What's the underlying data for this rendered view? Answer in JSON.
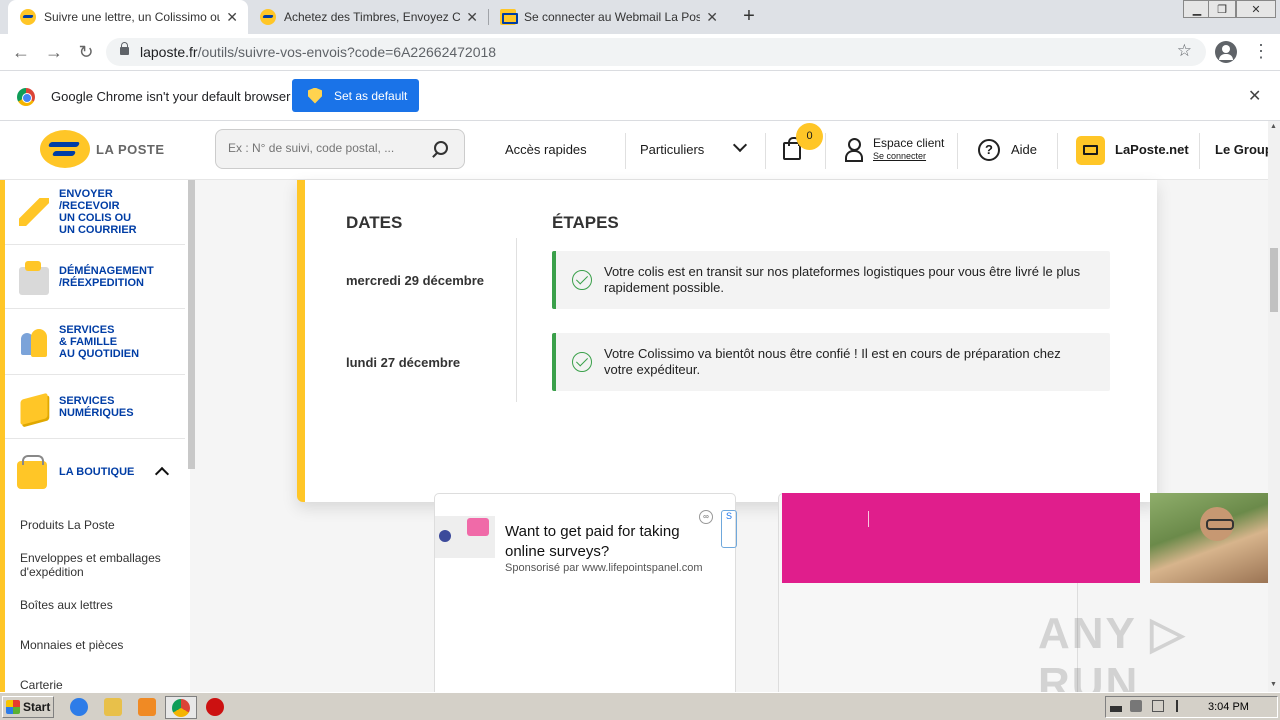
{
  "browser": {
    "tabs": [
      {
        "title": "Suivre une lettre, un Colissimo ou un",
        "active": true
      },
      {
        "title": "Achetez des Timbres, Envoyez Courr",
        "active": false
      },
      {
        "title": "Se connecter au Webmail La Poste -",
        "active": false
      }
    ],
    "tab_close": "✕",
    "new_tab": "+",
    "url_host": "laposte.fr",
    "url_path": "/outils/suivre-vos-envois?code=6A22662472018",
    "nav": {
      "back": "←",
      "forward": "→",
      "reload": "↻"
    },
    "bookmark_star": "☆",
    "menu": "⋮",
    "window_controls": {
      "minimize": "▁",
      "restore": "❐",
      "close": "✕"
    }
  },
  "infobar": {
    "message": "Google Chrome isn't your default browser",
    "button": "Set as default",
    "close": "✕"
  },
  "header": {
    "logo_text": "LA POSTE",
    "search_placeholder": "Ex : N° de suivi, code postal, ...",
    "quick_access": "Accès rapides",
    "audience": "Particuliers",
    "cart_count": "0",
    "account_title": "Espace client",
    "account_sub": "Se connecter",
    "help": "Aide",
    "webmail": "LaPoste.net",
    "group": "Le Group"
  },
  "sidebar": {
    "items": [
      {
        "label": [
          "ENVOYER",
          "/RECEVOIR",
          "UN COLIS OU",
          "UN COURRIER"
        ],
        "icon": "paper-plane-icon"
      },
      {
        "label": [
          "DÉMÉNAGEMENT",
          "/RÉEXPEDITION"
        ],
        "icon": "moving-box-icon"
      },
      {
        "label": [
          "SERVICES",
          "& FAMILLE",
          "AU QUOTIDIEN"
        ],
        "icon": "family-icon"
      },
      {
        "label": [
          "SERVICES",
          "NUMÉRIQUES"
        ],
        "icon": "digital-icon"
      },
      {
        "label": [
          "LA BOUTIQUE"
        ],
        "icon": "shopping-basket-icon"
      }
    ],
    "boutique_links": [
      [
        "Produits La Poste"
      ],
      [
        "Enveloppes et emballages",
        "d'expédition"
      ],
      [
        "Boîtes aux lettres"
      ],
      [
        "Monnaies et pièces"
      ],
      [
        "Carterie"
      ]
    ]
  },
  "tracking": {
    "dates_header": "DATES",
    "steps_header": "ÉTAPES",
    "events": [
      {
        "date": "mercredi 29 décembre",
        "text": "Votre colis est en transit sur nos plateformes logistiques pour vous être livré le plus rapidement possible."
      },
      {
        "date": "lundi 27 décembre",
        "text": "Votre Colissimo va bientôt nous être confié ! Il est en cours de préparation chez votre expéditeur."
      }
    ],
    "status_color": "#3aa04a",
    "accent_color": "#ffc627"
  },
  "ads": {
    "title": "Want to get paid for taking online surveys?",
    "sponsor": "Sponsorisé par www.lifepointspanel.com",
    "choice": "∞",
    "mark": "S",
    "pink_color": "#e01e8c"
  },
  "watermark": "ANY ▷ RUN",
  "taskbar": {
    "start": "Start",
    "time": "3:04 PM"
  }
}
